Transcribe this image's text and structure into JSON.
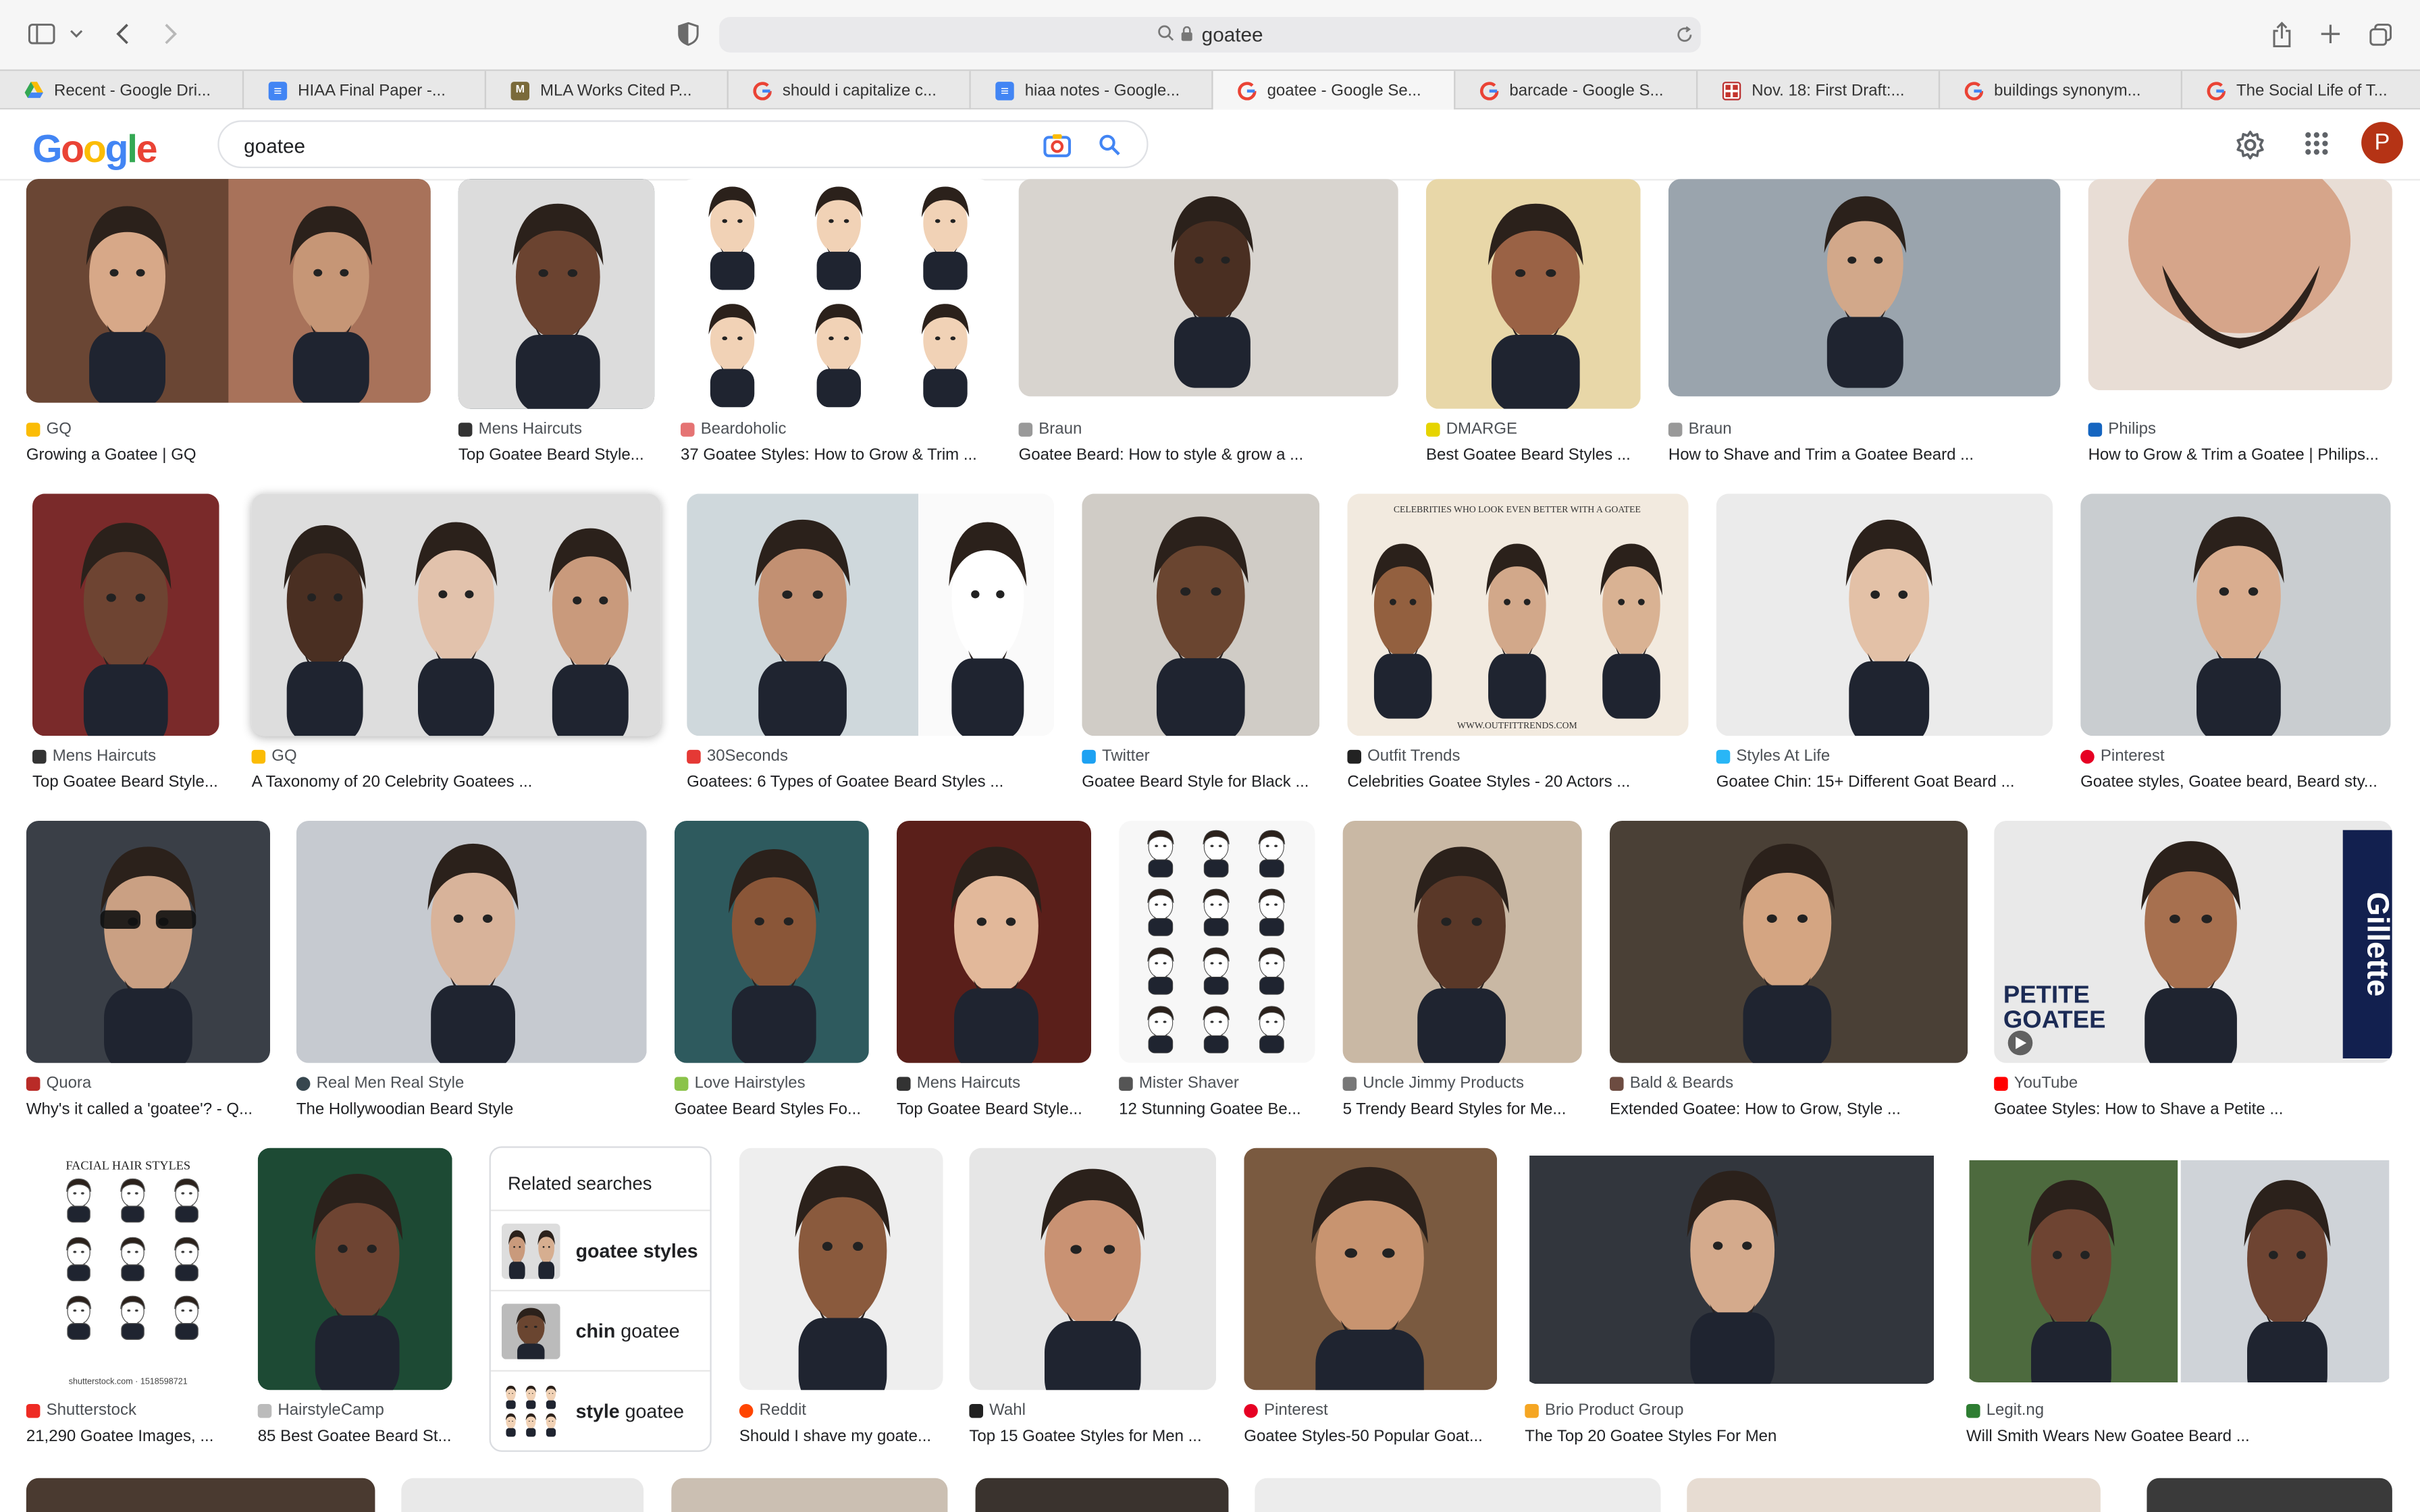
{
  "browser": {
    "url": "goatee",
    "tabs": [
      {
        "label": "Recent - Google Dri...",
        "icon": "google-drive-icon"
      },
      {
        "label": "HIAA Final Paper -...",
        "icon": "google-docs-icon"
      },
      {
        "label": "MLA Works Cited P...",
        "icon": "mla-site-icon"
      },
      {
        "label": "should i capitalize c...",
        "icon": "google-g-icon"
      },
      {
        "label": "hiaa notes - Google...",
        "icon": "google-docs-icon"
      },
      {
        "label": "goatee - Google Se...",
        "icon": "google-g-icon",
        "active": true
      },
      {
        "label": "barcade - Google S...",
        "icon": "google-g-icon"
      },
      {
        "label": "Nov. 18: First Draft:...",
        "icon": "brown-site-icon"
      },
      {
        "label": "buildings synonym...",
        "icon": "google-g-icon"
      },
      {
        "label": "The Social Life of T...",
        "icon": "google-g-icon"
      }
    ]
  },
  "google": {
    "logo": "Google",
    "query": "goatee",
    "avatar_letter": "P"
  },
  "results": [
    {
      "source": "GQ",
      "title": "Growing a Goatee | GQ"
    },
    {
      "source": "Mens Haircuts",
      "title": "Top Goatee Beard Style..."
    },
    {
      "source": "Beardoholic",
      "title": "37 Goatee Styles: How to Grow & Trim ..."
    },
    {
      "source": "Braun",
      "title": "Goatee Beard: How to style & grow a ..."
    },
    {
      "source": "DMARGE",
      "title": "Best Goatee Beard Styles ..."
    },
    {
      "source": "Braun",
      "title": "How to Shave and Trim a Goatee Beard ..."
    },
    {
      "source": "Philips",
      "title": "How to Grow & Trim a Goatee | Philips..."
    },
    {
      "source": "Mens Haircuts",
      "title": "Top Goatee Beard Style..."
    },
    {
      "source": "GQ",
      "title": "A Taxonomy of 20 Celebrity Goatees ..."
    },
    {
      "source": "30Seconds",
      "title": "Goatees: 6 Types of Goatee Beard Styles ..."
    },
    {
      "source": "Twitter",
      "title": "Goatee Beard Style for Black ..."
    },
    {
      "source": "Outfit Trends",
      "title": "Celebrities Goatee Styles - 20 Actors ..."
    },
    {
      "source": "Styles At Life",
      "title": "Goatee Chin: 15+ Different Goat Beard ..."
    },
    {
      "source": "Pinterest",
      "title": "Goatee styles, Goatee beard, Beard sty..."
    },
    {
      "source": "Quora",
      "title": "Why's it called a 'goatee'? - Q..."
    },
    {
      "source": "Real Men Real Style",
      "title": "The Hollywoodian Beard Style"
    },
    {
      "source": "Love Hairstyles",
      "title": "Goatee Beard Styles Fo..."
    },
    {
      "source": "Mens Haircuts",
      "title": "Top Goatee Beard Style..."
    },
    {
      "source": "Mister Shaver",
      "title": "12 Stunning Goatee Be..."
    },
    {
      "source": "Uncle Jimmy Products",
      "title": "5 Trendy Beard Styles for Me..."
    },
    {
      "source": "Bald & Beards",
      "title": "Extended Goatee: How to Grow, Style ..."
    },
    {
      "source": "YouTube",
      "title": "Goatee Styles: How to Shave a Petite ..."
    },
    {
      "source": "Shutterstock",
      "title": "21,290 Goatee Images, ..."
    },
    {
      "source": "HairstyleCamp",
      "title": "85 Best Goatee Beard St..."
    },
    {
      "source": "Reddit",
      "title": "Should I shave my goate..."
    },
    {
      "source": "Wahl",
      "title": "Top 15 Goatee Styles for Men ..."
    },
    {
      "source": "Pinterest",
      "title": "Goatee Styles-50 Popular Goat..."
    },
    {
      "source": "Brio Product Group",
      "title": "The Top 20 Goatee Styles For Men"
    },
    {
      "source": "Legit.ng",
      "title": "Will Smith Wears New Goatee Beard ..."
    }
  ],
  "related": {
    "heading": "Related searches",
    "items": [
      {
        "bold": "goatee styles",
        "pre": ""
      },
      {
        "bold": "chin",
        "post": " goatee"
      },
      {
        "bold": "style",
        "post": " goatee"
      }
    ]
  },
  "overlay_text": {
    "petite": "PETITE",
    "goatee": "GOATEE",
    "gillette": "Gillette",
    "outfit_banner": "CELEBRITIES WHO LOOK EVEN BETTER WITH A GOATEE",
    "outfit_url": "WWW.OUTFITTRENDS.COM",
    "facial_hair": "FACIAL HAIR STYLES",
    "shutter_id": "shutterstock.com · 1518598721"
  },
  "colors": {
    "google_blue": "#4285f4",
    "google_red": "#ea4335",
    "google_yellow": "#fbbc05",
    "google_green": "#34a853",
    "avatar": "#b53315"
  }
}
